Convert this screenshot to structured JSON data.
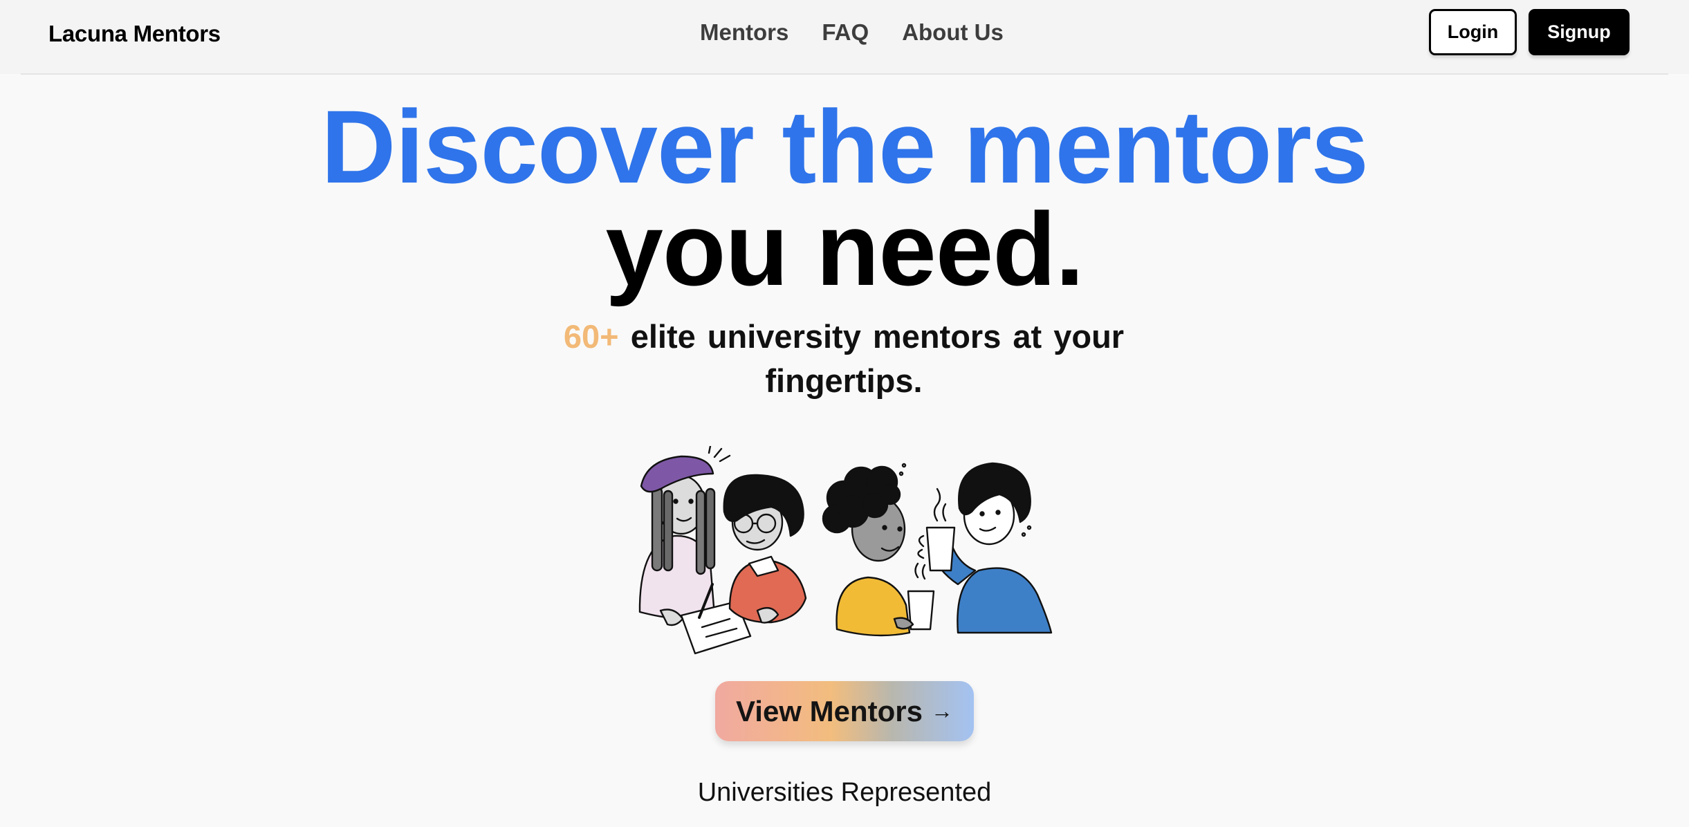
{
  "nav": {
    "brand": "Lacuna Mentors",
    "links": [
      "Mentors",
      "FAQ",
      "About Us"
    ],
    "login_label": "Login",
    "signup_label": "Signup"
  },
  "hero": {
    "line1": "Discover the mentors",
    "line2": "you need.",
    "sub_accent": "60+",
    "sub_text": "elite university mentors at your fingertips.",
    "cta_label": "View Mentors",
    "cta_arrow": "→"
  },
  "section": {
    "universities_title": "Universities Represented"
  },
  "colors": {
    "accent_blue": "#2f74ea",
    "accent_orange": "#f2b977"
  }
}
